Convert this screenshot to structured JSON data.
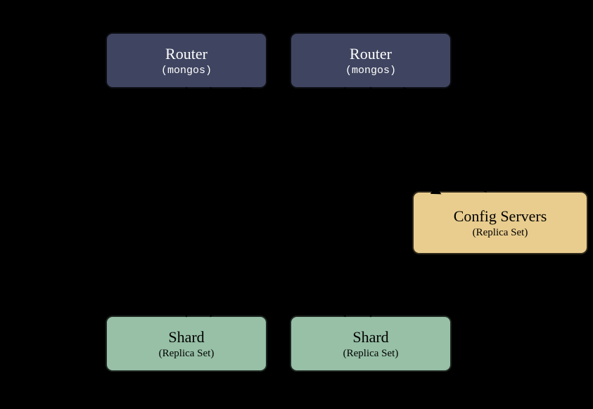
{
  "routers": [
    {
      "title": "Router",
      "subtitle": "(mongos)"
    },
    {
      "title": "Router",
      "subtitle": "(mongos)"
    }
  ],
  "config": {
    "title": "Config Servers",
    "subtitle": "(Replica Set)"
  },
  "shards": [
    {
      "title": "Shard",
      "subtitle": "(Replica Set)"
    },
    {
      "title": "Shard",
      "subtitle": "(Replica Set)"
    }
  ]
}
